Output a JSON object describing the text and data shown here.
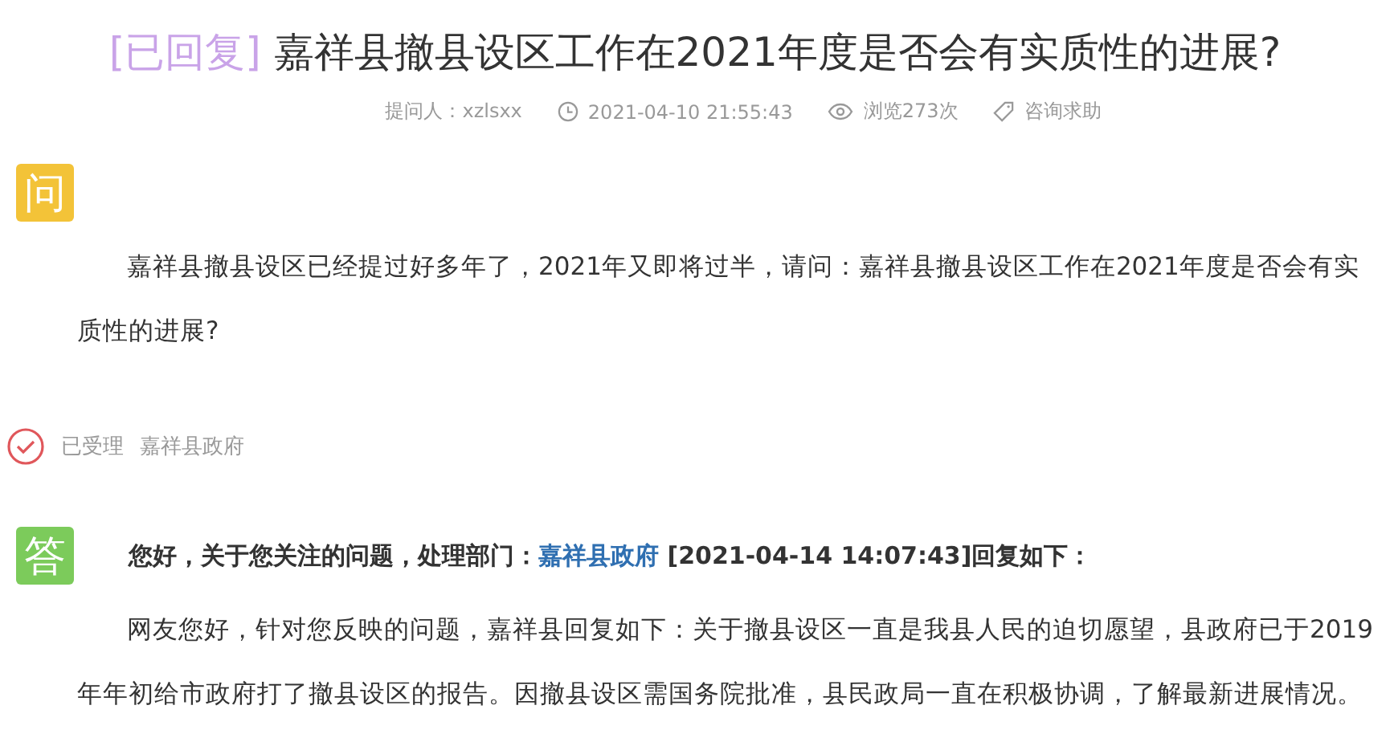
{
  "title": {
    "tag": "[已回复]",
    "text": "嘉祥县撤县设区工作在2021年度是否会有实质性的进展?"
  },
  "meta": [
    {
      "kind": "asker",
      "text": "提问人：xzlsxx"
    },
    {
      "kind": "time",
      "text": "2021-04-10 21:55:43"
    },
    {
      "kind": "views",
      "text": "浏览273次"
    },
    {
      "kind": "category",
      "text": "咨询求助"
    }
  ],
  "question": {
    "badge": "问",
    "text": "嘉祥县撤县设区已经提过好多年了，2021年又即将过半，请问：嘉祥县撤县设区工作在2021年度是否会有实质性的进展?"
  },
  "status": {
    "label": "已受理",
    "department": "嘉祥县政府"
  },
  "answer": {
    "badge": "答",
    "header_before": "您好，关于您关注的问题，处理部门：",
    "department_link": "嘉祥县政府",
    "header_after": " [2021-04-14 14:07:43]回复如下：",
    "text": "网友您好，针对您反映的问题，嘉祥县回复如下：关于撤县设区一直是我县人民的迫切愿望，县政府已于2019年年初给市政府打了撤县设区的报告。因撤县设区需国务院批准，县民政局一直在积极协调，了解最新进展情况。"
  }
}
